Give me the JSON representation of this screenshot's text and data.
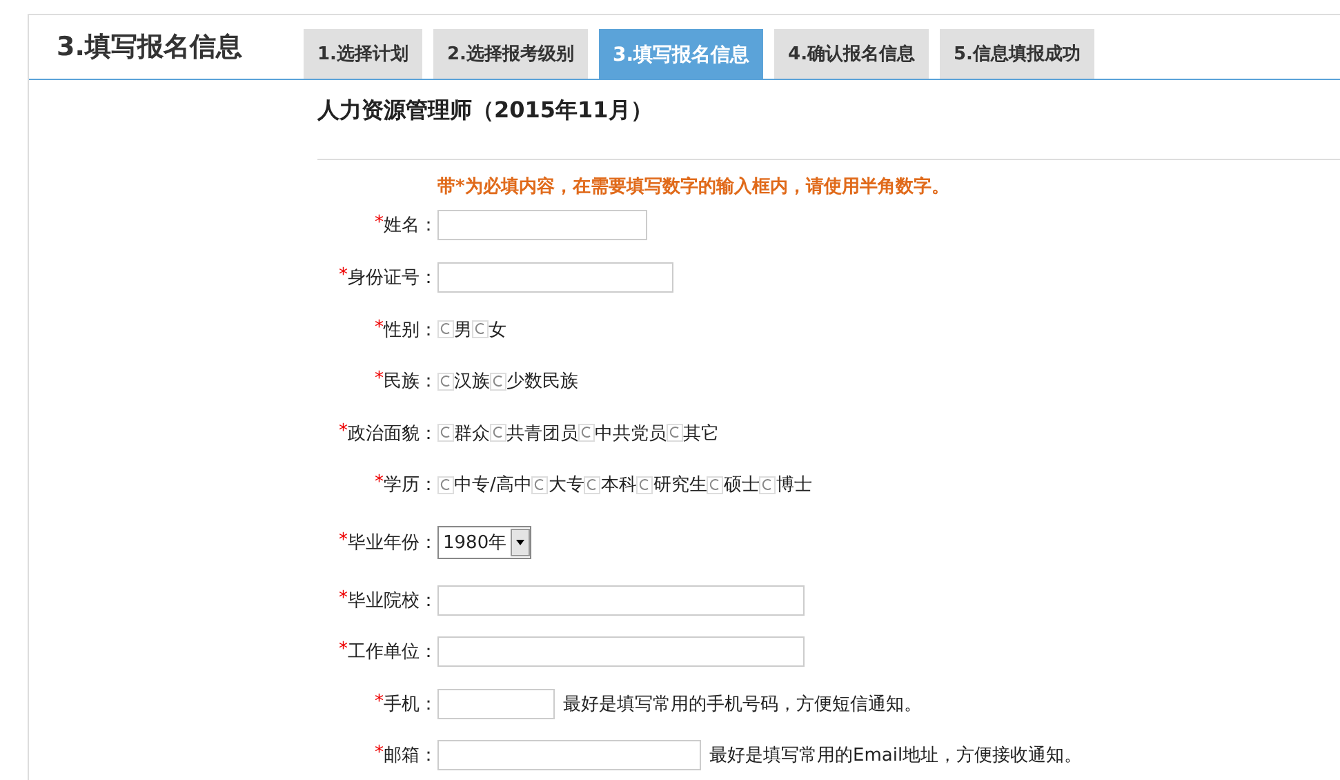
{
  "header": {
    "title": "3.填写报名信息"
  },
  "tabs": [
    {
      "label": "1.选择计划",
      "selected": false
    },
    {
      "label": "2.选择报考级别",
      "selected": false
    },
    {
      "label": "3.填写报名信息",
      "selected": true
    },
    {
      "label": "4.确认报名信息",
      "selected": false
    },
    {
      "label": "5.信息填报成功",
      "selected": false
    }
  ],
  "exam_title": "人力资源管理师（2015年11月）",
  "notice": "带*为必填内容，在需要填写数字的输入框内，请使用半角数字。",
  "required_mark": "*",
  "fields": [
    {
      "kind": "text",
      "label": "姓名：",
      "required": true
    },
    {
      "kind": "text",
      "label": "身份证号：",
      "required": true
    },
    {
      "kind": "radio",
      "label": "性别：",
      "required": true,
      "options": [
        {
          "label": "男",
          "selected": false
        },
        {
          "label": "女",
          "selected": false
        }
      ]
    },
    {
      "kind": "radio",
      "label": "民族：",
      "required": true,
      "options": [
        {
          "label": "汉族",
          "selected": false
        },
        {
          "label": "少数民族",
          "selected": false
        }
      ]
    },
    {
      "kind": "radio",
      "label": "政治面貌：",
      "required": true,
      "options": [
        {
          "label": "群众",
          "selected": false
        },
        {
          "label": "共青团员",
          "selected": false
        },
        {
          "label": "中共党员",
          "selected": false
        },
        {
          "label": "其它",
          "selected": false
        }
      ]
    },
    {
      "kind": "radio",
      "label": "学历：",
      "required": true,
      "options": [
        {
          "label": "中专/高中",
          "selected": false
        },
        {
          "label": "大专",
          "selected": false
        },
        {
          "label": "本科",
          "selected": false
        },
        {
          "label": "研究生",
          "selected": false
        },
        {
          "label": "硕士",
          "selected": false
        },
        {
          "label": "博士",
          "selected": false
        }
      ]
    },
    {
      "kind": "select",
      "label": "毕业年份：",
      "required": true,
      "value": "1980年"
    },
    {
      "kind": "text",
      "label": "毕业院校：",
      "required": true
    },
    {
      "kind": "text",
      "label": "工作单位：",
      "required": true
    },
    {
      "kind": "text",
      "label": "手机：",
      "required": true,
      "hint": "最好是填写常用的手机号码，方便短信通知。"
    },
    {
      "kind": "text",
      "label": "邮箱：",
      "required": true,
      "hint": "最好是填写常用的Email地址，方便接收通知。"
    }
  ]
}
